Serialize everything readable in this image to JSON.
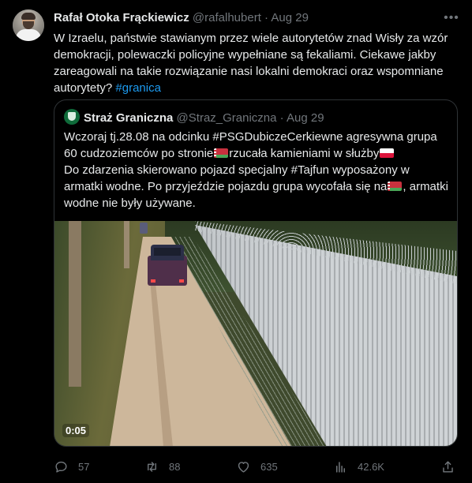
{
  "tweet": {
    "author_name": "Rafał Otoka Frąckiewicz",
    "handle": "@rafalhubert",
    "separator": "·",
    "date": "Aug 29",
    "more_icon": "ellipsis-icon",
    "text_main": "W Izraelu, państwie stawianym przez wiele autorytetów znad Wisły  za wzór demokracji, polewaczki policyjne wypełniane są fekaliami. Ciekawe jakby zareagowali na takie rozwiązanie nasi lokalni demokraci oraz wspomniane autorytety? ",
    "hashtag": "#granica"
  },
  "quote": {
    "author_name": "Straż Graniczna",
    "handle": "@Straz_Graniczna",
    "separator": "·",
    "date": "Aug 29",
    "text_1": "Wczoraj tj.28.08 na odcinku #PSGDubiczeCerkiewne agresywna grupa 60 cudzoziemców po stronie",
    "text_2": "rzucała kamieniami w służby",
    "text_3": "Do zdarzenia skierowano pojazd specjalny #Tajfun wyposażony w armatki wodne. Po przyjeździe pojazdu grupa wycofała się na",
    "text_4": ", armatki wodne nie były używane.",
    "video_time": "0:05"
  },
  "actions": {
    "replies": "57",
    "retweets": "88",
    "likes": "635",
    "views": "42.6K"
  },
  "colors": {
    "background": "#000000",
    "text": "#e7e9ea",
    "muted": "#71767b",
    "link": "#1d9bf0",
    "border": "#2f3336"
  }
}
